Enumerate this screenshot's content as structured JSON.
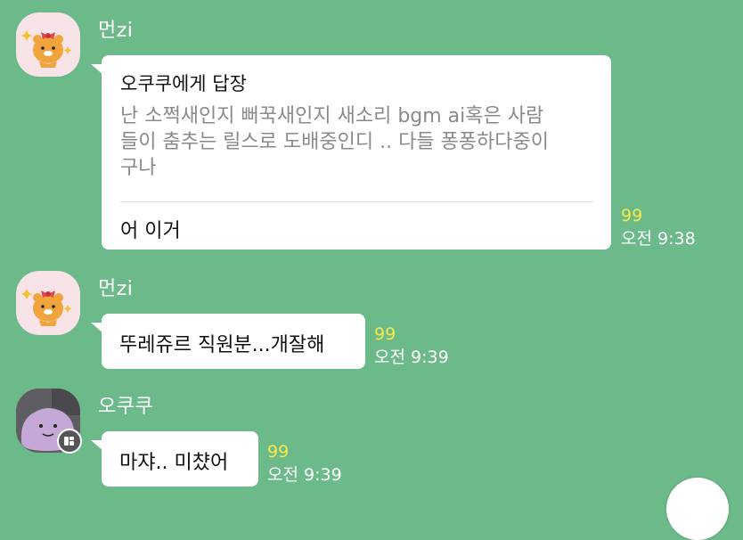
{
  "messages": [
    {
      "sender": "먼zi",
      "reply": {
        "header": "오쿠쿠에게 답장",
        "quote_lines": [
          "난 소쩍새인지 뻐꾹새인지 새소리 bgm ai혹은 사람",
          "들이 춤추는 릴스로 도배중인디 .. 다들 퐁퐁하다중이",
          "구나"
        ],
        "text": "어 이거"
      },
      "unread": "99",
      "time": "오전 9:38"
    },
    {
      "sender": "먼zi",
      "text": "뚜레쥬르 직원분...개잘해",
      "unread": "99",
      "time": "오전 9:39"
    },
    {
      "sender": "오쿠쿠",
      "text": "마쟈.. 미챴어",
      "unread": "99",
      "time": "오전 9:39"
    }
  ],
  "colors": {
    "background": "#6cb98a",
    "bubble": "#ffffff",
    "unread": "#f5e94d",
    "quote_text": "#8a8a8a"
  },
  "icons": {
    "avatar_1": "ryan-character-icon",
    "avatar_2": "ryan-character-icon",
    "avatar_3": "ditto-character-icon",
    "badge": "multi-profile-badge-icon",
    "scroll": "scroll-down-button"
  }
}
